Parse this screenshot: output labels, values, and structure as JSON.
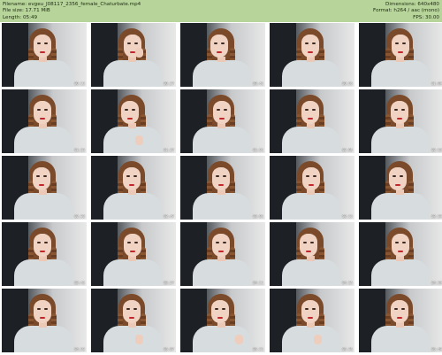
{
  "header": {
    "filename": "Filename: evgeu_J08117_2356_female_Chaturbate.mp4",
    "filesize": "File size: 17.71 MiB",
    "length": "Length: 05:49",
    "dimensions": "Dimensions: 640x480",
    "format": "Format: h264 / aac (mono)",
    "fps": "FPS: 30.00"
  },
  "thumbs": [
    {
      "ts": "00:13"
    },
    {
      "ts": "00:27"
    },
    {
      "ts": "00:41"
    },
    {
      "ts": "00:55"
    },
    {
      "ts": "01:09"
    },
    {
      "ts": "01:23"
    },
    {
      "ts": "01:37"
    },
    {
      "ts": "01:51"
    },
    {
      "ts": "02:05"
    },
    {
      "ts": "02:19"
    },
    {
      "ts": "02:33"
    },
    {
      "ts": "02:47"
    },
    {
      "ts": "03:01"
    },
    {
      "ts": "03:15"
    },
    {
      "ts": "03:29"
    },
    {
      "ts": "03:43"
    },
    {
      "ts": "03:57"
    },
    {
      "ts": "04:11"
    },
    {
      "ts": "04:25"
    },
    {
      "ts": "04:39"
    },
    {
      "ts": "04:53"
    },
    {
      "ts": "05:07"
    },
    {
      "ts": "05:21"
    },
    {
      "ts": "05:35"
    },
    {
      "ts": "05:49"
    }
  ]
}
